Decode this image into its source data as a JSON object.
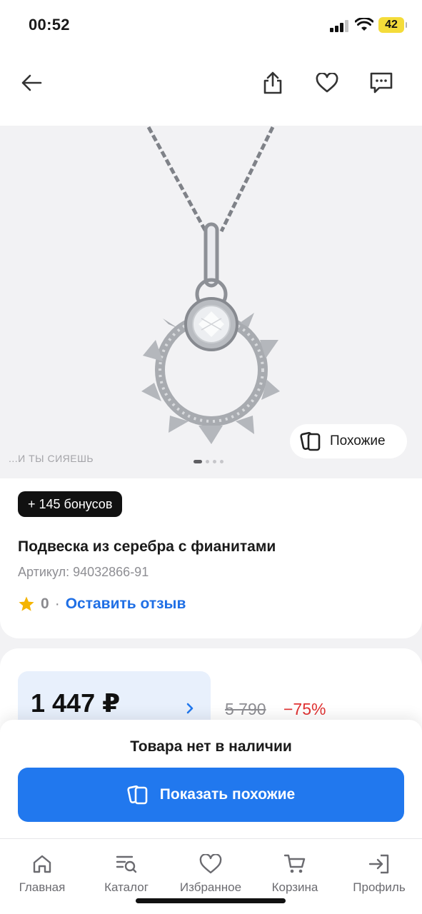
{
  "status_bar": {
    "time": "00:52",
    "battery": "42"
  },
  "top_nav": {
    "back_icon": "arrow-left-icon",
    "share_icon": "share-icon",
    "favorite_icon": "heart-icon",
    "chat_icon": "chat-icon"
  },
  "gallery": {
    "brand_caption": "...И ТЫ СИЯЕШЬ",
    "similar_label": "Похожие",
    "page_count": 4,
    "active_page": 1
  },
  "product": {
    "bonus": "+ 145 бонусов",
    "title": "Подвеска из серебра с фианитами",
    "sku": "Артикул: 94032866-91",
    "rating": "0",
    "rating_separator": "·",
    "review_link": "Оставить отзыв"
  },
  "price": {
    "current": "1 447 ₽",
    "old": "5 790",
    "discount": "−75%"
  },
  "availability": {
    "status": "Товара нет в наличии",
    "show_similar": "Показать похожие"
  },
  "tabbar": {
    "items": [
      {
        "label": "Главная",
        "icon": "home-icon"
      },
      {
        "label": "Каталог",
        "icon": "catalog-icon"
      },
      {
        "label": "Избранное",
        "icon": "heart-icon"
      },
      {
        "label": "Корзина",
        "icon": "cart-icon"
      },
      {
        "label": "Профиль",
        "icon": "login-icon"
      }
    ]
  },
  "colors": {
    "accent": "#2178ee",
    "link": "#1f6fe5",
    "discount": "#e03232",
    "price_bg": "#e8f0fc",
    "star": "#f4b400"
  }
}
